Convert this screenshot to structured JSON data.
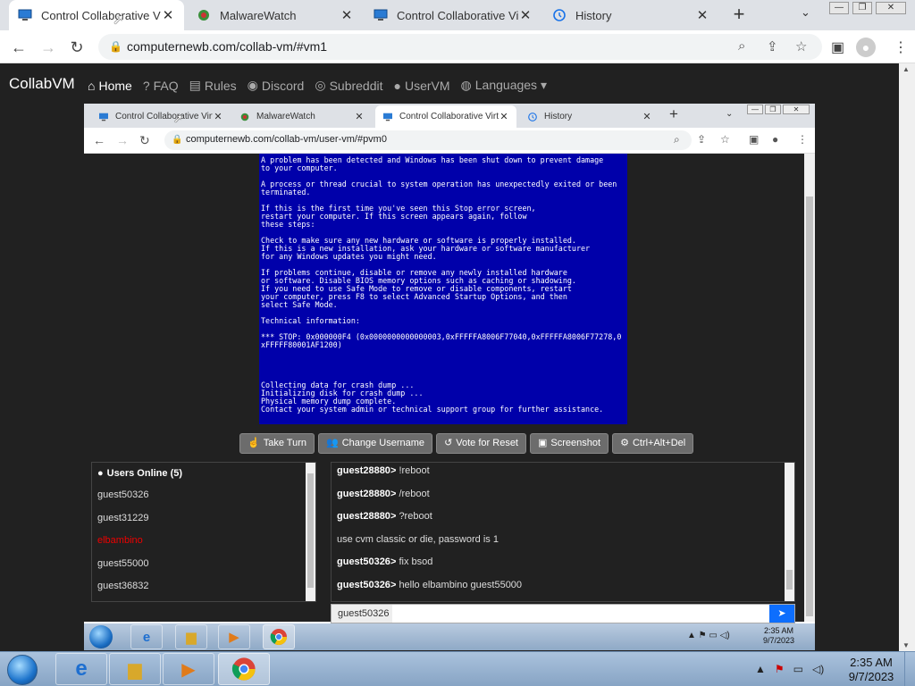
{
  "outer_browser": {
    "tabs": [
      {
        "label": "Control Collaborative Virt",
        "active": true
      },
      {
        "label": "MalwareWatch",
        "active": false
      },
      {
        "label": "Control Collaborative Virt",
        "active": false
      },
      {
        "label": "History",
        "active": false
      }
    ],
    "close_glyph": "✕",
    "new_tab_glyph": "+",
    "tab_menu_glyph": "⌄",
    "url": "computernewb.com/collab-vm/#vm1",
    "window_buttons": [
      "—",
      "❐",
      "✕"
    ]
  },
  "site": {
    "brand": "CollabVM",
    "nav": [
      {
        "label": "Home",
        "icon": "home-icon",
        "glyph": "⌂",
        "active": true
      },
      {
        "label": "FAQ",
        "icon": "question-icon",
        "glyph": "?",
        "active": false
      },
      {
        "label": "Rules",
        "icon": "clipboard-icon",
        "glyph": "▤",
        "active": false
      },
      {
        "label": "Discord",
        "icon": "discord-icon",
        "glyph": "◉",
        "active": false
      },
      {
        "label": "Subreddit",
        "icon": "reddit-icon",
        "glyph": "◎",
        "active": false
      },
      {
        "label": "UserVM",
        "icon": "user-icon",
        "glyph": "●",
        "active": false
      },
      {
        "label": "Languages ▾",
        "icon": "globe-icon",
        "glyph": "◍",
        "active": false
      }
    ]
  },
  "vm": {
    "browser": {
      "tabs": [
        {
          "label": "Control Collaborative Virt",
          "active": false
        },
        {
          "label": "MalwareWatch",
          "active": false
        },
        {
          "label": "Control Collaborative Virt",
          "active": true
        },
        {
          "label": "History",
          "active": false
        }
      ],
      "url": "computernewb.com/collab-vm/user-vm/#pvm0"
    },
    "bsod_text": "A problem has been detected and Windows has been shut down to prevent damage\nto your computer.\n\nA process or thread crucial to system operation has unexpectedly exited or been\nterminated.\n\nIf this is the first time you've seen this Stop error screen,\nrestart your computer. If this screen appears again, follow\nthese steps:\n\nCheck to make sure any new hardware or software is properly installed.\nIf this is a new installation, ask your hardware or software manufacturer\nfor any Windows updates you might need.\n\nIf problems continue, disable or remove any newly installed hardware\nor software. Disable BIOS memory options such as caching or shadowing.\nIf you need to use Safe Mode to remove or disable components, restart\nyour computer, press F8 to select Advanced Startup Options, and then\nselect Safe Mode.\n\nTechnical information:\n\n*** STOP: 0x000000F4 (0x0000000000000003,0xFFFFFA8006F77040,0xFFFFFA8006F77278,0\nxFFFFF80001AF1200)\n\n\n\n\nCollecting data for crash dump ...\nInitializing disk for crash dump ...\nPhysical memory dump complete.\nContact your system admin or technical support group for further assistance.",
    "buttons": [
      {
        "label": "Take Turn",
        "icon": "hand-icon",
        "glyph": "☝"
      },
      {
        "label": "Change Username",
        "icon": "users-icon",
        "glyph": "👥"
      },
      {
        "label": "Vote for Reset",
        "icon": "reset-icon",
        "glyph": "↺"
      },
      {
        "label": "Screenshot",
        "icon": "camera-icon",
        "glyph": "▣"
      },
      {
        "label": "Ctrl+Alt+Del",
        "icon": "gear-icon",
        "glyph": "⚙"
      }
    ],
    "users_header": "Users Online (5)",
    "users": [
      {
        "name": "guest50326",
        "admin": false
      },
      {
        "name": "guest31229",
        "admin": false
      },
      {
        "name": "elbambino",
        "admin": true
      },
      {
        "name": "guest55000",
        "admin": false
      },
      {
        "name": "guest36832",
        "admin": false
      }
    ],
    "chat": [
      {
        "user": "guest28880",
        "text": "!reboot"
      },
      {
        "user": "guest28880",
        "text": "/reboot"
      },
      {
        "user": "guest28880",
        "text": "?reboot"
      },
      {
        "user": "",
        "text": "use cvm classic or die, password is 1"
      },
      {
        "user": "guest50326",
        "text": "fix bsod"
      },
      {
        "user": "guest50326",
        "text": "hello elbambino guest55000"
      }
    ],
    "chat_username": "guest50326",
    "chat_input_value": "",
    "taskbar_time": "2:35 AM",
    "taskbar_date": "9/7/2023"
  },
  "taskbar": {
    "time": "2:35 AM",
    "date": "9/7/2023"
  },
  "colors": {
    "bsod_blue": "#0000aa",
    "site_bg": "#212121",
    "send_blue": "#0d6efd",
    "admin_red": "#ee0000"
  }
}
